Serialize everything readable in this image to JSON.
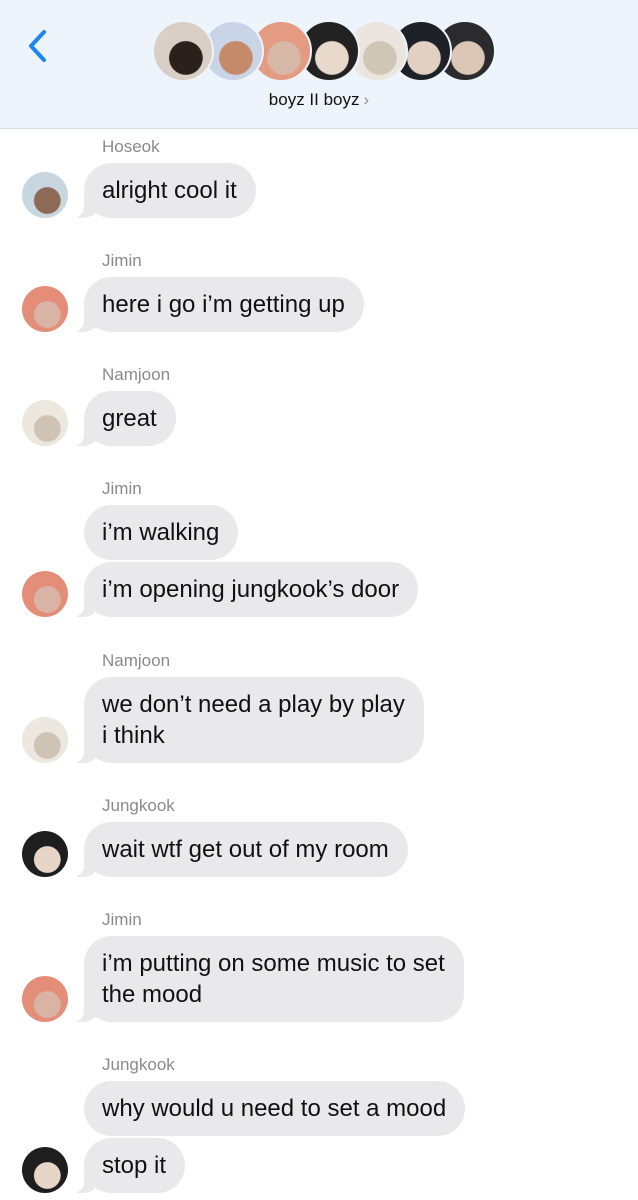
{
  "header": {
    "title": "boyz II boyz",
    "title_chevron": "›",
    "back_icon": "chevron-left-icon",
    "accent_color": "#1c86f2",
    "group_avatars": [
      {
        "colors": [
          "#d9cfc6",
          "#2a211c"
        ]
      },
      {
        "colors": [
          "#c9d4e6",
          "#c48a6a"
        ]
      },
      {
        "colors": [
          "#e59a82",
          "#d7b8a6"
        ]
      },
      {
        "colors": [
          "#222222",
          "#e8d9cc"
        ]
      },
      {
        "colors": [
          "#eae6df",
          "#cfc6b6"
        ]
      },
      {
        "colors": [
          "#1f2128",
          "#e2d0c2"
        ]
      },
      {
        "colors": [
          "#2b2a2c",
          "#dcc7b7"
        ]
      }
    ]
  },
  "messages": [
    {
      "sender": "Hoseok",
      "bubbles": [
        "alright cool it"
      ],
      "avatar": {
        "colors": [
          "#c8d6df",
          "#8d6a55"
        ]
      }
    },
    {
      "sender": "Jimin",
      "bubbles": [
        "here i go i’m getting up"
      ],
      "avatar": {
        "colors": [
          "#e48e79",
          "#d9b4a6"
        ]
      }
    },
    {
      "sender": "Namjoon",
      "bubbles": [
        "great"
      ],
      "avatar": {
        "colors": [
          "#ece7df",
          "#cfc3b4"
        ]
      }
    },
    {
      "sender": "Jimin",
      "bubbles": [
        "i’m walking",
        "i’m opening jungkook’s door"
      ],
      "avatar": {
        "colors": [
          "#e48e79",
          "#d9b4a6"
        ]
      }
    },
    {
      "sender": "Namjoon",
      "bubbles": [
        "we don’t need a play by play\ni think"
      ],
      "avatar": {
        "colors": [
          "#ece7df",
          "#cfc3b4"
        ]
      }
    },
    {
      "sender": "Jungkook",
      "bubbles": [
        "wait wtf get out of my room"
      ],
      "avatar": {
        "colors": [
          "#1e1e1e",
          "#e7d6c7"
        ]
      }
    },
    {
      "sender": "Jimin",
      "bubbles": [
        "i’m putting on some music to set\nthe mood"
      ],
      "avatar": {
        "colors": [
          "#e48e79",
          "#d9b4a6"
        ]
      }
    },
    {
      "sender": "Jungkook",
      "bubbles": [
        "why would u need to set a mood",
        "stop it"
      ],
      "avatar": {
        "colors": [
          "#1e1e1e",
          "#e7d6c7"
        ]
      }
    }
  ]
}
